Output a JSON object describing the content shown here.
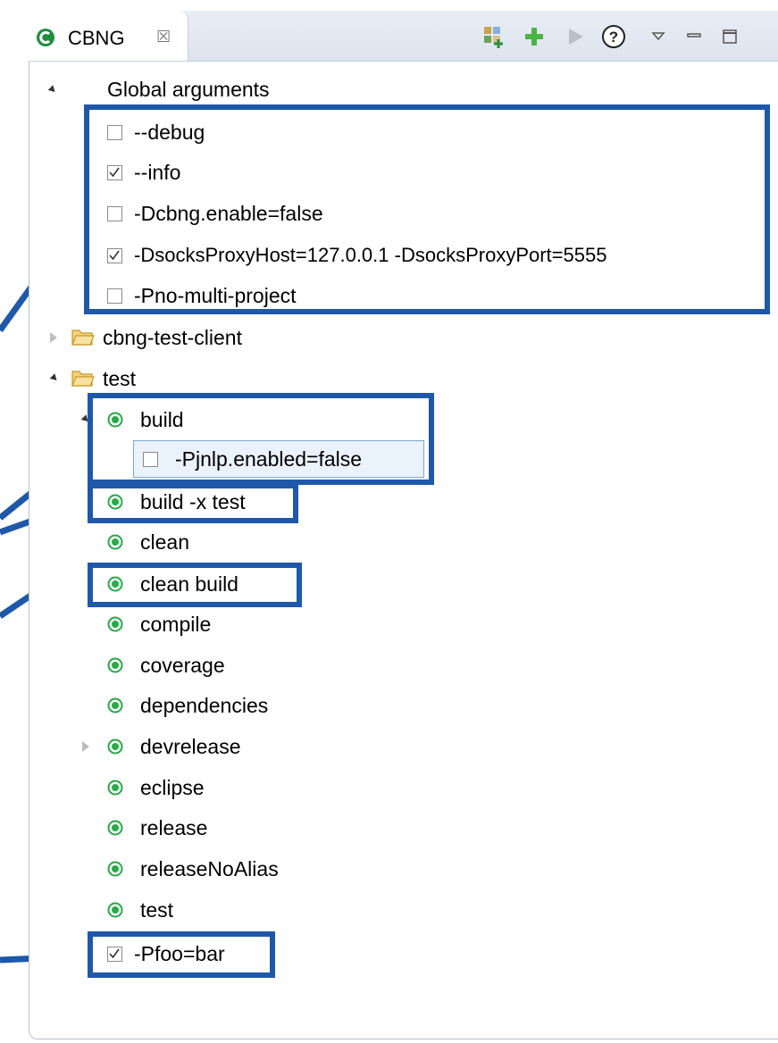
{
  "tab": {
    "title": "CBNG",
    "close_glyph": "☒"
  },
  "toolbar": {
    "icons": [
      "gradle-tasks-icon",
      "add-icon",
      "run-icon",
      "help-icon",
      "view-menu-icon",
      "minimize-icon",
      "maximize-icon"
    ],
    "help_glyph": "?"
  },
  "tree": {
    "global_arguments_label": "Global arguments",
    "global_args": [
      {
        "label": "--debug",
        "checked": false
      },
      {
        "label": "--info",
        "checked": true
      },
      {
        "label": "-Dcbng.enable=false",
        "checked": false
      },
      {
        "label": "-DsocksProxyHost=127.0.0.1 -DsocksProxyPort=5555",
        "checked": true
      },
      {
        "label": "-Pno-multi-project",
        "checked": false
      }
    ],
    "projects": [
      {
        "label": "cbng-test-client",
        "expanded": false
      },
      {
        "label": "test",
        "expanded": true
      }
    ],
    "tasks": [
      {
        "label": "build"
      },
      {
        "label": "-Pjnlp.enabled=false",
        "checked": false
      },
      {
        "label": "build -x test"
      },
      {
        "label": "clean"
      },
      {
        "label": "clean build"
      },
      {
        "label": "compile"
      },
      {
        "label": "coverage"
      },
      {
        "label": "dependencies"
      },
      {
        "label": "devrelease"
      },
      {
        "label": "eclipse"
      },
      {
        "label": "release"
      },
      {
        "label": "releaseNoAlias"
      },
      {
        "label": "test"
      },
      {
        "label": "-Pfoo=bar",
        "checked": true
      }
    ]
  },
  "colors": {
    "highlight_box": "#1f58a8",
    "task_icon": "#2aa84a",
    "folder": "#e8b23a"
  }
}
